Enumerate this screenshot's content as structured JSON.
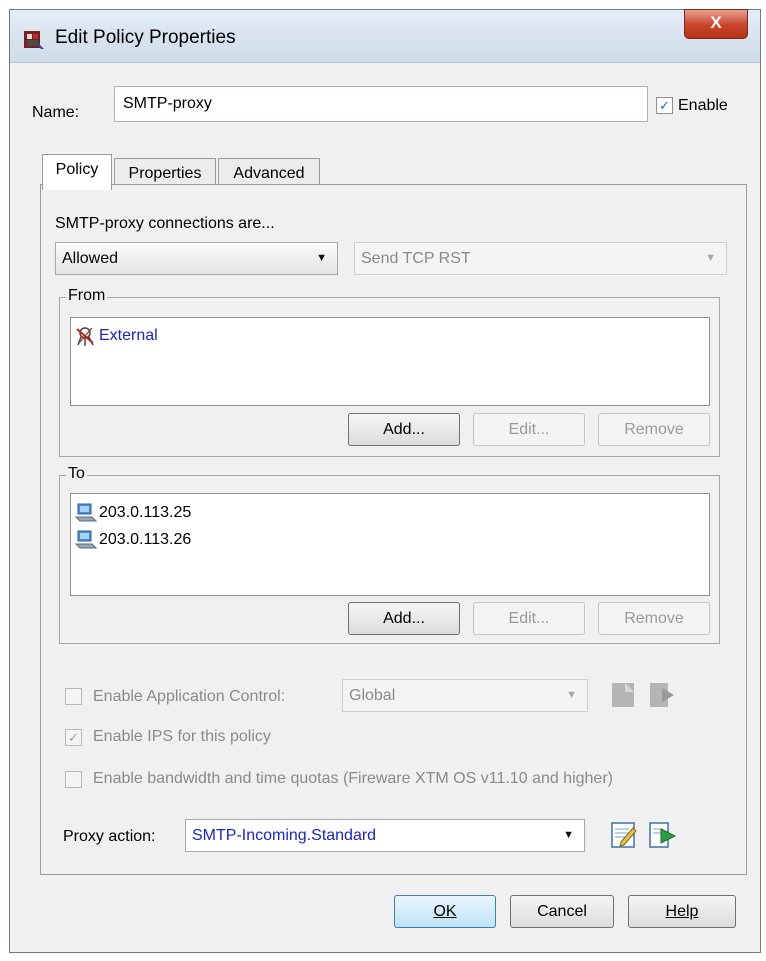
{
  "window": {
    "title": "Edit Policy Properties",
    "close_icon": "close-x-icon",
    "close_label": "X"
  },
  "name_row": {
    "label": "Name:",
    "value": "SMTP-proxy",
    "enable_label": "Enable",
    "enable_checked": true
  },
  "tabs": [
    {
      "label": "Policy",
      "active": true
    },
    {
      "label": "Properties",
      "active": false
    },
    {
      "label": "Advanced",
      "active": false
    }
  ],
  "policy": {
    "connections_label": "SMTP-proxy connections are...",
    "action_value": "Allowed",
    "reject_value": "Send TCP RST",
    "from": {
      "legend": "From",
      "items": [
        {
          "label": "External",
          "icon": "external-alias-icon"
        }
      ],
      "add": "Add...",
      "edit": "Edit...",
      "remove": "Remove"
    },
    "to": {
      "legend": "To",
      "items": [
        {
          "label": "203.0.113.25",
          "icon": "host-computer-icon"
        },
        {
          "label": "203.0.113.26",
          "icon": "host-computer-icon"
        }
      ],
      "add": "Add...",
      "edit": "Edit...",
      "remove": "Remove"
    },
    "app_control": {
      "label": "Enable Application Control:",
      "checked": false,
      "value": "Global"
    },
    "ips": {
      "label": "Enable IPS for this policy",
      "checked": true
    },
    "quotas": {
      "label": "Enable bandwidth and time quotas (Fireware XTM OS v11.10 and higher)",
      "checked": false
    },
    "proxy_action": {
      "label": "Proxy action:",
      "value": "SMTP-Incoming.Standard"
    }
  },
  "footer": {
    "ok": "OK",
    "cancel": "Cancel",
    "help": "Help"
  },
  "colors": {
    "link_blue": "#1a24c8",
    "titlebar": "#d9e4f1",
    "close_red": "#c8432a"
  }
}
